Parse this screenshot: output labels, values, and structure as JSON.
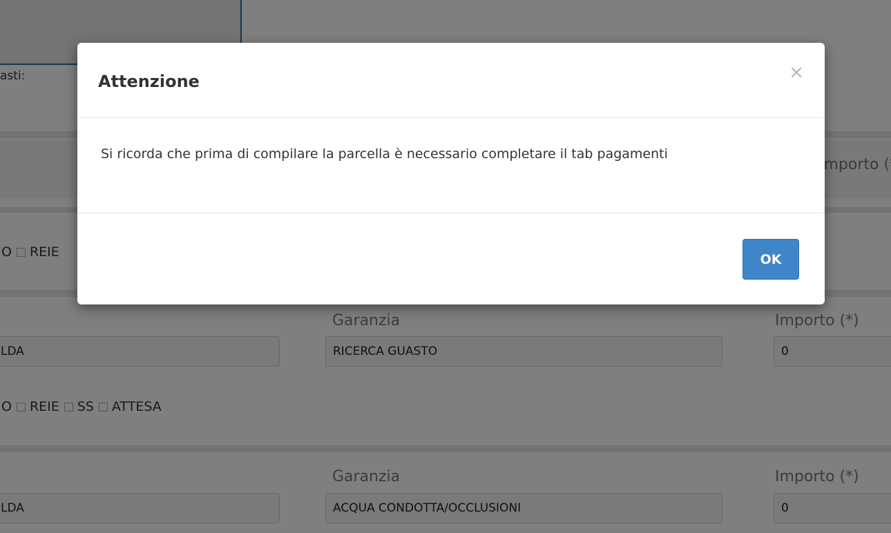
{
  "background": {
    "fasti_label": "asti:",
    "row1": {
      "importo_label": "Importo (*)"
    },
    "row1_checkboxes": [
      {
        "label": "O"
      },
      {
        "label": "REIE"
      }
    ],
    "row2": {
      "field1_value": "LDA",
      "garanzia_label": "Garanzia",
      "garanzia_value": "RICERCA GUASTO",
      "importo_label": "Importo (*)",
      "importo_value": "0"
    },
    "row2_checkboxes": [
      {
        "label": "O"
      },
      {
        "label": "REIE"
      },
      {
        "label": "SS"
      },
      {
        "label": "ATTESA"
      }
    ],
    "row3": {
      "field1_value": "LDA",
      "garanzia_label": "Garanzia",
      "garanzia_value": "ACQUA CONDOTTA/OCCLUSIONI",
      "importo_label": "Importo (*)",
      "importo_value": "0"
    }
  },
  "modal": {
    "title": "Attenzione",
    "close_symbol": "×",
    "message": "Si ricorda che prima di compilare la parcella è necessario completare il tab pagamenti",
    "ok_label": "OK",
    "ok_color": "#3e86c9"
  }
}
